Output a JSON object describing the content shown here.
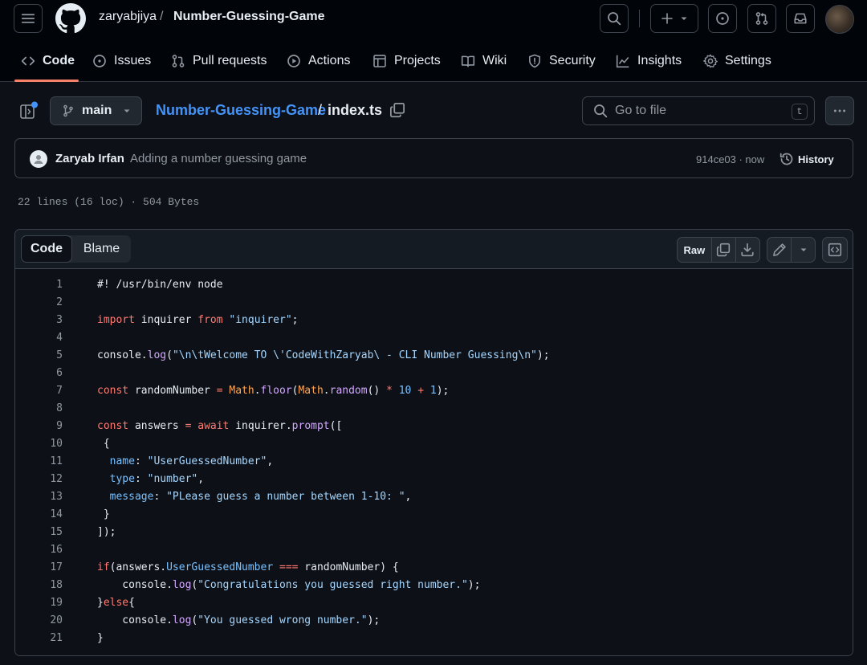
{
  "header": {
    "owner": "zaryabjiya",
    "separator": "/",
    "repo": "Number-Guessing-Game"
  },
  "nav": {
    "tabs": [
      {
        "label": "Code",
        "icon": "code-icon",
        "active": true
      },
      {
        "label": "Issues",
        "icon": "issue-icon"
      },
      {
        "label": "Pull requests",
        "icon": "pull-request-icon"
      },
      {
        "label": "Actions",
        "icon": "play-icon"
      },
      {
        "label": "Projects",
        "icon": "table-icon"
      },
      {
        "label": "Wiki",
        "icon": "book-icon"
      },
      {
        "label": "Security",
        "icon": "shield-icon"
      },
      {
        "label": "Insights",
        "icon": "graph-icon"
      },
      {
        "label": "Settings",
        "icon": "gear-icon"
      }
    ]
  },
  "file_header": {
    "branch": "main",
    "breadcrumb_repo": "Number-Guessing-Game",
    "breadcrumb_sep": "/",
    "file": "index.ts",
    "goto_placeholder": "Go to file",
    "goto_shortcut": "t"
  },
  "commit": {
    "author": "Zaryab Irfan",
    "message": "Adding a number guessing game",
    "sha_time": "914ce03 · now",
    "history_label": "History"
  },
  "file_stats": "22 lines (16 loc) · 504 Bytes",
  "code_view": {
    "tab_code": "Code",
    "tab_blame": "Blame",
    "raw_label": "Raw"
  },
  "colors": {
    "background": "#0d1117",
    "header": "#010409",
    "accent_underline": "#f78166",
    "link": "#4493f8",
    "keyword": "#ff7b72",
    "string": "#a5d6ff",
    "function": "#d2a8ff",
    "constant": "#79c0ff",
    "variable": "#ffa657"
  },
  "code_lines": [
    {
      "n": "1",
      "t": [
        [
          "#! /usr/bin/env node",
          ""
        ]
      ]
    },
    {
      "n": "2",
      "t": []
    },
    {
      "n": "3",
      "t": [
        [
          "import",
          "k"
        ],
        [
          " inquirer ",
          ""
        ],
        [
          "from",
          "k"
        ],
        [
          " ",
          ""
        ],
        [
          "\"inquirer\"",
          "s"
        ],
        [
          ";",
          ""
        ]
      ]
    },
    {
      "n": "4",
      "t": []
    },
    {
      "n": "5",
      "t": [
        [
          "console",
          ""
        ],
        [
          ".",
          ""
        ],
        [
          "log",
          "f"
        ],
        [
          "(",
          ""
        ],
        [
          "\"\\n\\tWelcome TO \\'CodeWithZaryab\\ - CLI Number Guessing\\n\"",
          "s"
        ],
        [
          ");",
          ""
        ]
      ]
    },
    {
      "n": "6",
      "t": []
    },
    {
      "n": "7",
      "t": [
        [
          "const",
          "k"
        ],
        [
          " randomNumber ",
          ""
        ],
        [
          "=",
          "k"
        ],
        [
          " ",
          ""
        ],
        [
          "Math",
          "v"
        ],
        [
          ".",
          ""
        ],
        [
          "floor",
          "f"
        ],
        [
          "(",
          ""
        ],
        [
          "Math",
          "v"
        ],
        [
          ".",
          ""
        ],
        [
          "random",
          "f"
        ],
        [
          "() ",
          ""
        ],
        [
          "*",
          "k"
        ],
        [
          " ",
          ""
        ],
        [
          "10",
          "c"
        ],
        [
          " ",
          ""
        ],
        [
          "+",
          "k"
        ],
        [
          " ",
          ""
        ],
        [
          "1",
          "c"
        ],
        [
          ");",
          ""
        ]
      ]
    },
    {
      "n": "8",
      "t": []
    },
    {
      "n": "9",
      "t": [
        [
          "const",
          "k"
        ],
        [
          " answers ",
          ""
        ],
        [
          "=",
          "k"
        ],
        [
          " ",
          ""
        ],
        [
          "await",
          "k"
        ],
        [
          " inquirer.",
          ""
        ],
        [
          "prompt",
          "f"
        ],
        [
          "([",
          ""
        ]
      ]
    },
    {
      "n": "10",
      "t": [
        [
          " {",
          ""
        ]
      ]
    },
    {
      "n": "11",
      "t": [
        [
          "  ",
          ""
        ],
        [
          "name",
          "c"
        ],
        [
          ": ",
          ""
        ],
        [
          "\"UserGuessedNumber\"",
          "s"
        ],
        [
          ",",
          ""
        ]
      ]
    },
    {
      "n": "12",
      "t": [
        [
          "  ",
          ""
        ],
        [
          "type",
          "c"
        ],
        [
          ": ",
          ""
        ],
        [
          "\"number\"",
          "s"
        ],
        [
          ",",
          ""
        ]
      ]
    },
    {
      "n": "13",
      "t": [
        [
          "  ",
          ""
        ],
        [
          "message",
          "c"
        ],
        [
          ": ",
          ""
        ],
        [
          "\"PLease guess a number between 1-10: \"",
          "s"
        ],
        [
          ",",
          ""
        ]
      ]
    },
    {
      "n": "14",
      "t": [
        [
          " }",
          ""
        ]
      ]
    },
    {
      "n": "15",
      "t": [
        [
          "]);",
          ""
        ]
      ]
    },
    {
      "n": "16",
      "t": []
    },
    {
      "n": "17",
      "t": [
        [
          "if",
          "k"
        ],
        [
          "(answers.",
          ""
        ],
        [
          "UserGuessedNumber",
          "c"
        ],
        [
          " ",
          ""
        ],
        [
          "===",
          "k"
        ],
        [
          " randomNumber) {",
          ""
        ]
      ]
    },
    {
      "n": "18",
      "t": [
        [
          "    console.",
          ""
        ],
        [
          "log",
          "f"
        ],
        [
          "(",
          ""
        ],
        [
          "\"Congratulations you guessed right number.\"",
          "s"
        ],
        [
          ");",
          ""
        ]
      ]
    },
    {
      "n": "19",
      "t": [
        [
          "}",
          ""
        ],
        [
          "else",
          "k"
        ],
        [
          "{",
          ""
        ]
      ]
    },
    {
      "n": "20",
      "t": [
        [
          "    console.",
          ""
        ],
        [
          "log",
          "f"
        ],
        [
          "(",
          ""
        ],
        [
          "\"You guessed wrong number.\"",
          "s"
        ],
        [
          ");",
          ""
        ]
      ]
    },
    {
      "n": "21",
      "t": [
        [
          "}",
          ""
        ]
      ]
    }
  ]
}
